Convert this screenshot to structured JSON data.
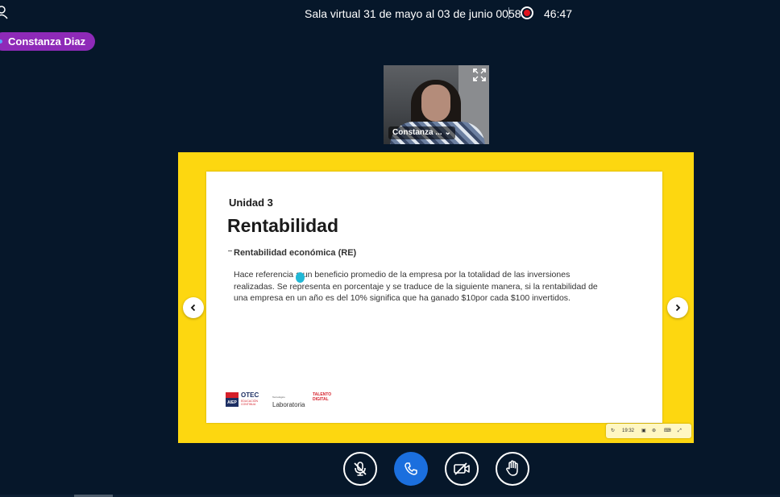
{
  "topbar": {
    "room_title": "Sala virtual 31 de mayo al 03 de junio 0058",
    "recording_time": "46:47",
    "recording_color": "#e0141e"
  },
  "presenter": {
    "name": "Constanza Diaz",
    "badge_color": "#8e2ab8"
  },
  "webcam": {
    "label": "Constanza ..."
  },
  "slide": {
    "unit": "Unidad 3",
    "title": "Rentabilidad",
    "subtitle": "Rentabilidad económica (RE)",
    "body": "Hace referencia a un beneficio promedio de la empresa por la totalidad de las inversiones realizadas. Se representa en porcentaje y se traduce de la siguiente manera, si la rentabilidad de una empresa en un año es del 10% significa que ha ganado $10por cada $100 invertidos.",
    "frame_color": "#fdd710",
    "logos": {
      "aiep": "AIEP",
      "otec": "OTEC",
      "otec_sub": "EDUCACIÓN CONTINUA",
      "lab_pre": "Tecnológico",
      "lab": "Laboratoria",
      "talento": "TALENTO DIGITAL"
    }
  },
  "slide_toolbar": {
    "time": "19:32"
  },
  "controls": {
    "mute_icon": "mic-off-icon",
    "leave_icon": "phone-icon",
    "video_icon": "video-off-icon",
    "raise_hand_icon": "hand-icon",
    "accent": "#1b6fde"
  }
}
